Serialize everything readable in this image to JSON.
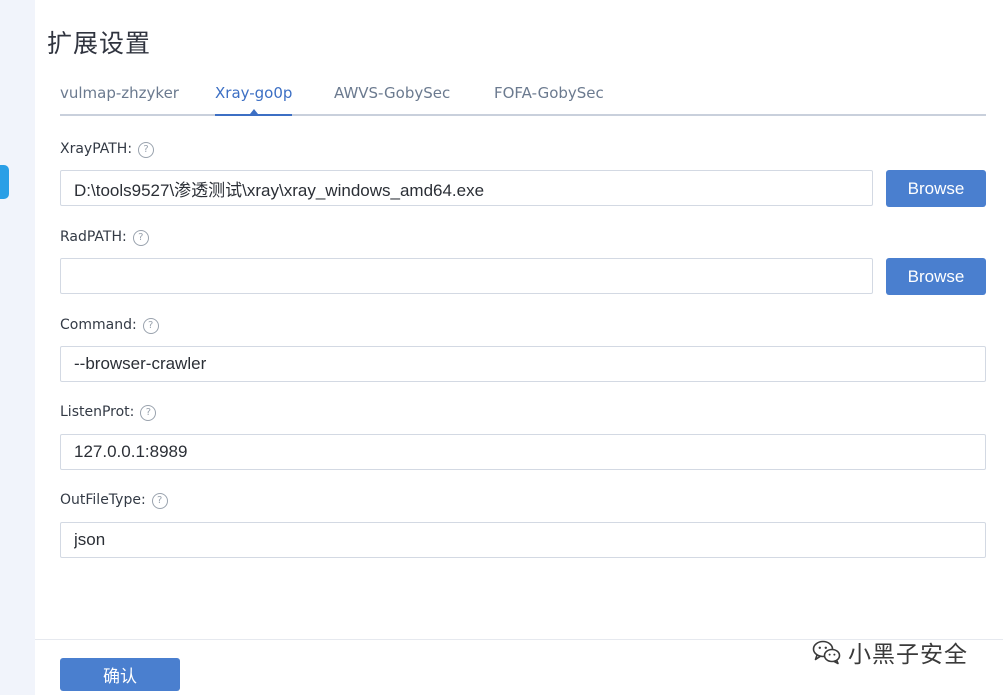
{
  "page": {
    "title": "扩展设置"
  },
  "tabs": [
    {
      "label": "vulmap-zhzyker",
      "active": false
    },
    {
      "label": "Xray-go0p",
      "active": true
    },
    {
      "label": "AWVS-GobySec",
      "active": false
    },
    {
      "label": "FOFA-GobySec",
      "active": false
    }
  ],
  "fields": {
    "xray_path": {
      "label": "XrayPATH:",
      "value": "D:\\tools9527\\渗透测试\\xray\\xray_windows_amd64.exe",
      "button": "Browse"
    },
    "rad_path": {
      "label": "RadPATH:",
      "value": "",
      "button": "Browse"
    },
    "command": {
      "label": "Command:",
      "value": "--browser-crawler"
    },
    "listen_port": {
      "label": "ListenProt:",
      "value": "127.0.0.1:8989"
    },
    "out_file_type": {
      "label": "OutFileType:",
      "value": "json"
    }
  },
  "help_glyph": "?",
  "footer": {
    "confirm_label": "确认"
  },
  "watermark": {
    "text": "小黑子安全",
    "icon": "wechat-icon"
  },
  "colors": {
    "accent": "#4a7fcf",
    "active_tab": "#3c6fc4",
    "sidebar_indicator": "#2a9fe6",
    "sidebar_bg": "#f1f4fb"
  }
}
